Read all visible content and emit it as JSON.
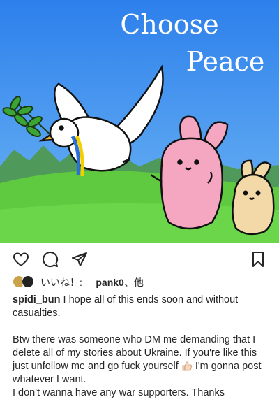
{
  "post": {
    "image": {
      "title_line1": "Choose",
      "title_line2": "Peace",
      "colors": {
        "sky": "#2f86ee",
        "grass": "#5fc93f",
        "bunny_pink": "#f5a7c2",
        "bunny_tan": "#f3d8a8"
      }
    },
    "actions": {
      "like_icon": "heart-icon",
      "comment_icon": "comment-icon",
      "share_icon": "send-icon",
      "save_icon": "bookmark-icon"
    },
    "likes": {
      "prefix": "いいね！: ",
      "user": "__pank0",
      "suffix": "、他"
    },
    "caption": {
      "username": "spidi_bun",
      "text1": " I hope all of this ends soon and without casualties.",
      "text2": "Btw there was someone who DM me demanding that I delete all of my stories about Ukraine. If you're like this just unfollow me and go fuck yourself ",
      "emoji": "thumbs-up-emoji",
      "text3": " I'm gonna post whatever I want.",
      "text4": "I don't wanna have any war supporters. Thanks"
    }
  }
}
